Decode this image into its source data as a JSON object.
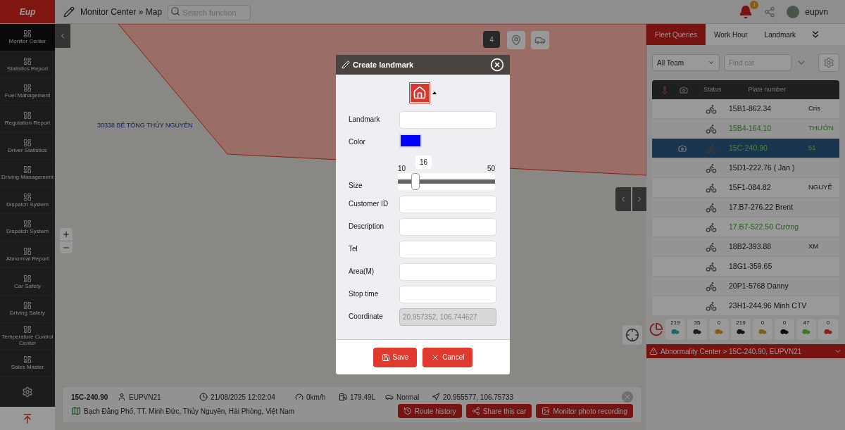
{
  "top_bar": {
    "logo": "Eup",
    "breadcrumb": [
      "Monitor Center",
      "Map"
    ],
    "separator": "»",
    "search": {
      "placeholder": "Search function"
    },
    "notification_count": "1",
    "user": "eupvn"
  },
  "sidebar": {
    "items": [
      {
        "label": "Monitor Center",
        "selected": true
      },
      {
        "label": "Statistics Report",
        "selected": false
      },
      {
        "label": "Fuel Management",
        "selected": false
      },
      {
        "label": "Regulation Report",
        "selected": false
      },
      {
        "label": "Driver Statistics",
        "selected": false
      },
      {
        "label": "Driving Management",
        "selected": false
      },
      {
        "label": "Dispatch System",
        "selected": false
      },
      {
        "label": "Dispatch System",
        "selected": false
      },
      {
        "label": "Abnormal Report",
        "selected": false
      },
      {
        "label": "Car Safety",
        "selected": false
      },
      {
        "label": "Driving Safety",
        "selected": false
      },
      {
        "label": "Temperature Control Center",
        "selected": false
      },
      {
        "label": "Sales Master",
        "selected": false
      }
    ]
  },
  "map": {
    "landmark_label": "30338 BÊ TÔNG THỦY NGUYÊN",
    "layer_count": "4"
  },
  "info_bar": {
    "plate": "15C-240.90",
    "driver": "EUPVN21",
    "time": "21/08/2025 12:02:04",
    "speed": "0km/h",
    "fuel": "179.49L",
    "status": "Normal",
    "coordinate": "20.955577, 106.75733",
    "address": "Bạch Đằng Phố, TT. Minh Đức, Thủy Nguyên, Hải Phòng, Việt Nam",
    "buttons": [
      "Route history",
      "Share this car",
      "Monitor photo recording"
    ]
  },
  "right_panel": {
    "tabs": [
      {
        "label": "Fleet Queries",
        "selected": true
      },
      {
        "label": "Work Hour",
        "selected": false
      },
      {
        "label": "Landmark",
        "selected": false
      }
    ],
    "team_select": "All Team",
    "find_car": {
      "placeholder": "Find car"
    },
    "columns": [
      "Status",
      "Plate number"
    ],
    "rows": [
      {
        "plate": "15B1-862.34",
        "column_5": "Cris",
        "color": "#141414",
        "camera": false,
        "selected": false
      },
      {
        "plate": "15B4-164.10",
        "column_5": "THƯỞN",
        "color": "#23601a",
        "camera": false,
        "selected": false
      },
      {
        "plate": "15C-240.90",
        "column_5": "51",
        "color": "#4a8a2a",
        "camera": true,
        "selected": true
      },
      {
        "plate": "15D1-222.76 ( Jan )",
        "color": "#111111",
        "camera": false,
        "selected": false
      },
      {
        "plate": "15F1-084.82",
        "column_5": "NGUYỄ",
        "color": "#111111",
        "camera": false,
        "selected": false
      },
      {
        "plate": "17.B7-276.22 Brent",
        "color": "#141414",
        "camera": false,
        "selected": false
      },
      {
        "plate": "17.B7-522.50 Cường",
        "color": "#23601a",
        "camera": false,
        "selected": false
      },
      {
        "plate": "18B2-393.88",
        "column_5": "XM",
        "color": "#111111",
        "camera": false,
        "selected": false
      },
      {
        "plate": "18G1-359.65",
        "color": "#141414",
        "camera": false,
        "selected": false
      },
      {
        "plate": "20P1-5768 Danny",
        "color": "#111111",
        "camera": false,
        "selected": false
      },
      {
        "plate": "23H1-244.96 Minh CTV",
        "color": "#111111",
        "camera": false,
        "selected": false
      }
    ],
    "stats": [
      {
        "count": "219",
        "color": "#1a6a6a"
      },
      {
        "count": "35",
        "color": "#1f1f1f"
      },
      {
        "count": "0",
        "color": "#8a5a10"
      },
      {
        "count": "219",
        "color": "#141414"
      },
      {
        "count": "0",
        "color": "#7a6218"
      },
      {
        "count": "0",
        "color": "#0a0a0a"
      },
      {
        "count": "47",
        "color": "#3a7a22"
      },
      {
        "count": "0",
        "color": "#8a2218"
      }
    ],
    "abnormality": "Abnormality Center > 15C-240.90, EUPVN21"
  },
  "dialog": {
    "title": "Create landmark",
    "fields": [
      {
        "label": "Landmark",
        "kind": "text"
      },
      {
        "label": "Color",
        "kind": "color",
        "color": "#0000ff"
      },
      {
        "label": "Size",
        "kind": "slider",
        "min": "10",
        "max": "50",
        "reading": "16",
        "level": 0.15
      },
      {
        "label": "Customer ID",
        "kind": "text"
      },
      {
        "label": "Description",
        "kind": "text"
      },
      {
        "label": "Tel",
        "kind": "text"
      },
      {
        "label": "Area(M)",
        "kind": "text"
      },
      {
        "label": "Stop time",
        "kind": "text"
      },
      {
        "label": "Coordinate",
        "kind": "readonly",
        "value": "20.957352, 106.744627"
      }
    ],
    "buttons": [
      {
        "label": "Save",
        "kind": "save"
      },
      {
        "label": "Cancel",
        "kind": "cancel"
      }
    ]
  }
}
